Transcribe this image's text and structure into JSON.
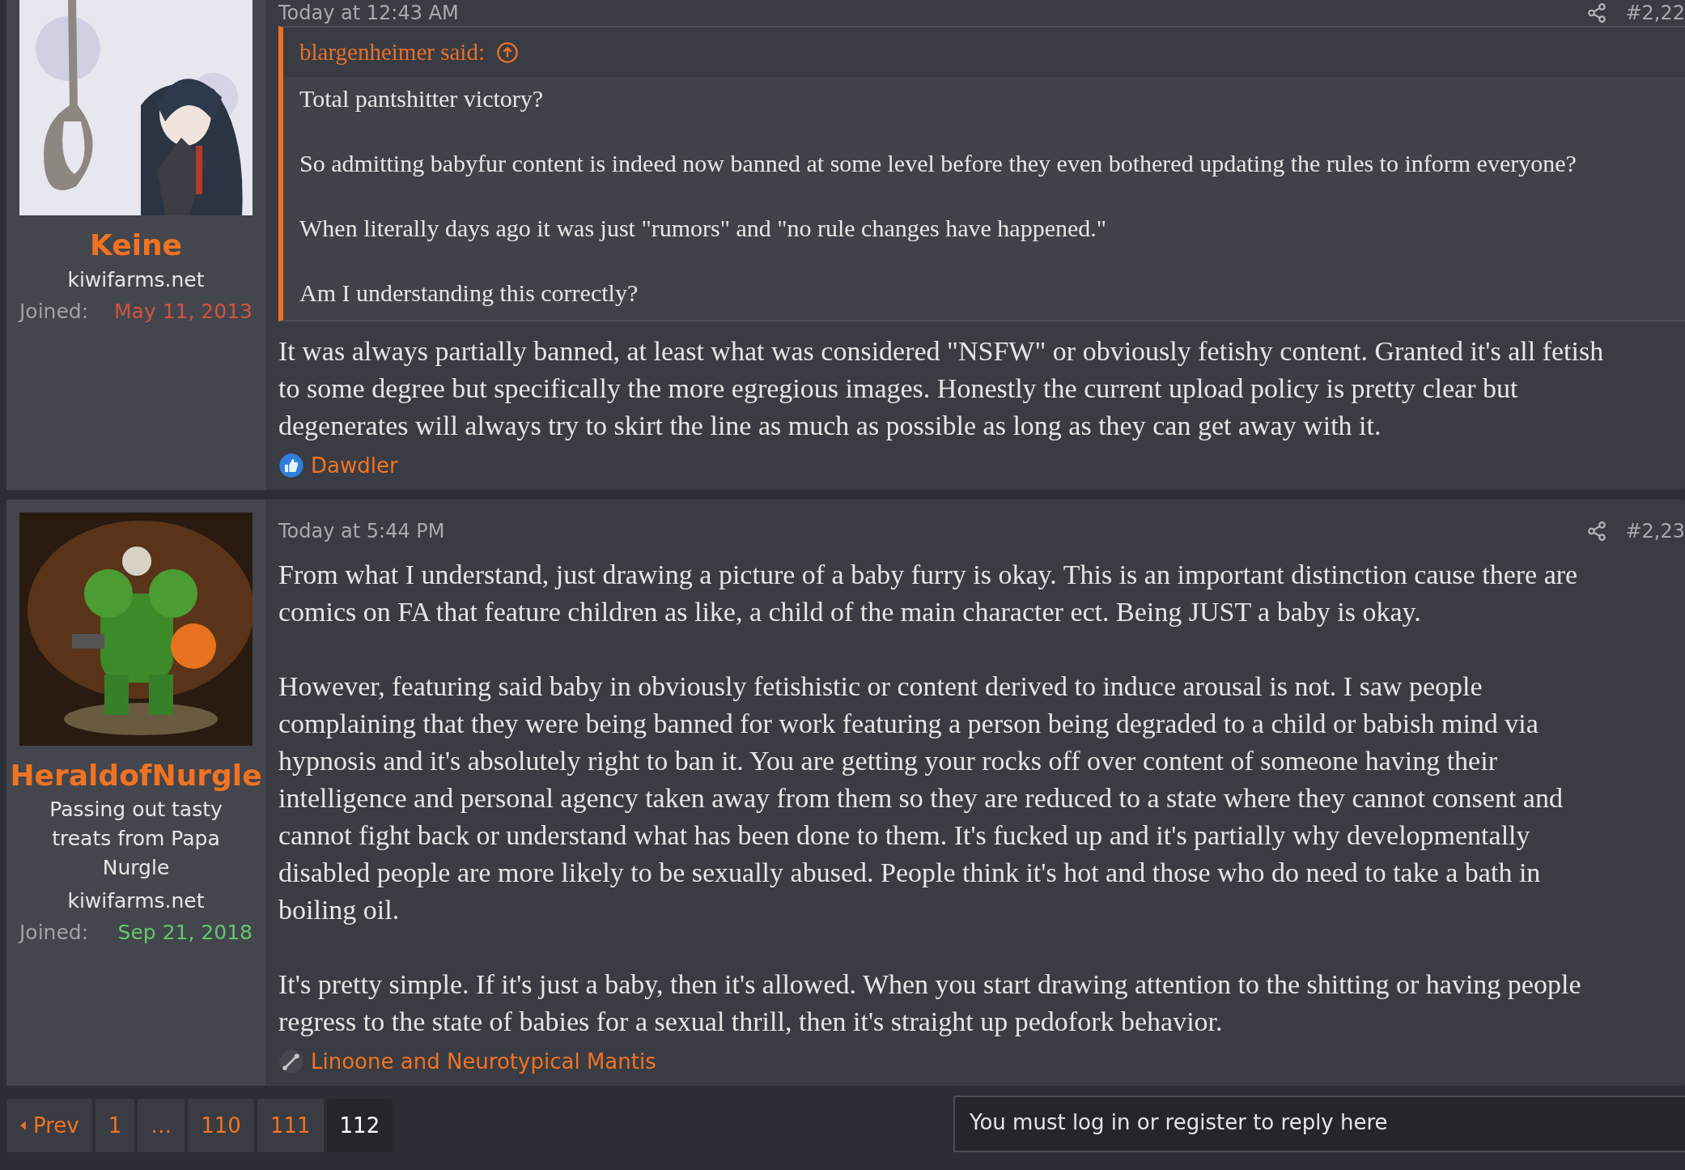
{
  "posts": [
    {
      "user": {
        "name": "Keine",
        "site": "kiwifarms.net",
        "joined_label": "Joined:",
        "joined": "May 11, 2013",
        "color": "#d2533f"
      },
      "date": "Today at 12:43 AM",
      "number": "#2,22",
      "quote": {
        "author": "blargenheimer said:",
        "paragraphs": [
          "Total pantshitter victory?",
          "So admitting babyfur content is indeed now banned at some level before they even bothered updating the rules to inform everyone?",
          "When literally days ago it was just \"rumors\" and \"no rule changes have happened.\"",
          "Am I understanding this correctly?"
        ]
      },
      "paragraphs": [
        "It was always partially banned, at least what was considered \"NSFW\" or obviously fetishy content. Granted it's all fetish\nto some degree but specifically the more egregious images. Honestly the current upload policy is pretty clear but\ndegenerates will always try to skirt the line as much as possible as long as they can get away with it."
      ],
      "reaction": {
        "kind": "like",
        "users": "Dawdler"
      }
    },
    {
      "user": {
        "name": "HeraldofNurgle",
        "title": "Passing out tasty treats from Papa Nurgle",
        "site": "kiwifarms.net",
        "joined_label": "Joined:",
        "joined": "Sep 21, 2018",
        "color": "#63c86a"
      },
      "date": "Today at 5:44 PM",
      "number": "#2,23",
      "paragraphs": [
        "From what I understand, just drawing a picture of a baby furry is okay. This is an important distinction cause there are\ncomics on FA that feature children as like, a child of the main character ect. Being JUST a baby is okay.",
        "However, featuring said baby in obviously fetishistic or content derived to induce arousal is not. I saw people\ncomplaining that they were being banned for work featuring a person being degraded to a child or babish mind via\nhypnosis and it's absolutely right to ban it. You are getting your rocks off over content of someone having their\nintelligence and personal agency taken away from them so they are reduced to a state where they cannot consent and\ncannot fight back or understand what has been done to them. It's fucked up and it's partially why developmentally\ndisabled people are more likely to be sexually abused. People think it's hot and those who do need to take a bath in\nboiling oil.",
        "It's pretty simple. If it's just a baby, then it's allowed. When you start drawing attention to the shitting or having people\nregress to the state of babies for a sexual thrill, then it's straight up pedofork behavior."
      ],
      "reaction": {
        "kind": "tool",
        "users": "Linoone and Neurotypical Mantis"
      }
    }
  ],
  "pagination": [
    {
      "kind": "prev",
      "label": "Prev",
      "selected": false
    },
    {
      "kind": "page",
      "label": "1",
      "selected": false
    },
    {
      "kind": "ellipsis",
      "label": "…",
      "selected": false
    },
    {
      "kind": "page",
      "label": "110",
      "selected": false
    },
    {
      "kind": "page",
      "label": "111",
      "selected": false
    },
    {
      "kind": "page",
      "label": "112",
      "selected": true
    }
  ],
  "reply_notice": "You must log in or register to reply here"
}
